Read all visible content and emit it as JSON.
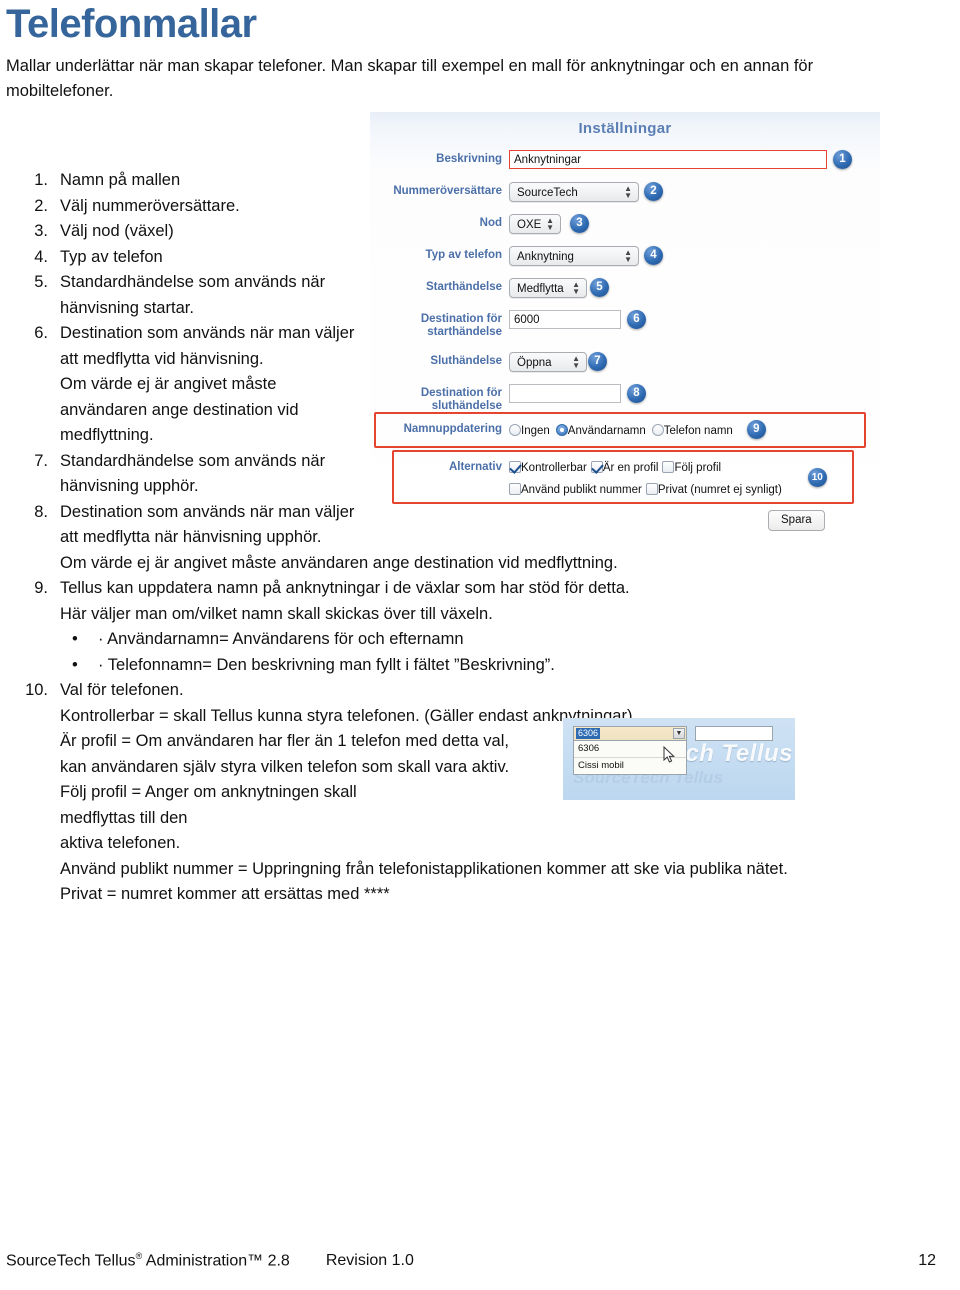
{
  "document": {
    "title": "Telefonmallar",
    "intro": "Mallar underlättar när man skapar telefoner. Man skapar till exempel en mall för anknytningar och en annan för mobiltelefoner."
  },
  "list": [
    {
      "num": "1.",
      "text": "Namn på mallen",
      "width": "narrow"
    },
    {
      "num": "2.",
      "text": "Välj nummeröversättare.",
      "width": "narrow"
    },
    {
      "num": "3.",
      "text": "Välj nod (växel)",
      "width": "narrow"
    },
    {
      "num": "4.",
      "text": "Typ av telefon",
      "width": "narrow"
    },
    {
      "num": "5.",
      "text": "Standardhändelse som används när hänvisning startar.",
      "width": "narrow"
    },
    {
      "num": "6.",
      "text": "Destination som används när man väljer att medflytta vid hänvisning.",
      "width": "narrow"
    },
    {
      "num": "",
      "text": "Om värde ej är angivet måste användaren ange destination vid medflyttning.",
      "width": "narrow"
    },
    {
      "num": "7.",
      "text": "Standardhändelse som används när hänvisning upphör.",
      "width": "narrow"
    },
    {
      "num": "8.",
      "text": "Destination som används när man väljer att medflytta när hänvisning upphör.",
      "width": "narrow"
    },
    {
      "num": "",
      "text": "Om värde ej är angivet måste användaren ange destination vid medflyttning.",
      "width": "wide"
    },
    {
      "num": "9.",
      "text": "Tellus kan uppdatera namn på anknytningar i de växlar som har stöd för detta.",
      "width": "wide"
    },
    {
      "num": "",
      "text": "Här väljer man om/vilket namn skall skickas över till växeln.",
      "width": "wide"
    }
  ],
  "bullets": [
    {
      "dot": "•",
      "text": "· Användarnamn= Användarens för och efternamn"
    },
    {
      "dot": "•",
      "text": "· Telefonnamn= Den beskrivning man fyllt i fältet ”Beskrivning”."
    }
  ],
  "list_tail": [
    {
      "num": "10.",
      "text": "Val för telefonen.",
      "width": "wide"
    },
    {
      "num": "",
      "text": "Kontrollerbar = skall Tellus kunna styra telefonen. (Gäller endast anknytningar)",
      "width": "wide"
    },
    {
      "num": "",
      "text": "Är profil = Om användaren har fler än 1 telefon med detta val,",
      "width": "wide"
    },
    {
      "num": "",
      "text": "kan användaren själv styra vilken telefon som skall vara aktiv.",
      "width": "wide"
    },
    {
      "num": "",
      "text": "Följ profil = Anger om anknytningen skall medflyttas till den",
      "width": "narrow-tail"
    },
    {
      "num": "",
      "text": "aktiva telefonen.",
      "width": "narrow-tail"
    },
    {
      "num": "",
      "text": "Använd publikt nummer = Uppringning från telefonistapplikationen kommer att ske via publika nätet.",
      "width": "wide"
    },
    {
      "num": "",
      "text": "Privat = numret kommer att ersättas med ****",
      "width": "wide"
    }
  ],
  "screenshot": {
    "title": "Inställningar",
    "fields": {
      "beskrivning": {
        "label": "Beskrivning",
        "value": "Anknytningar",
        "badge": "1"
      },
      "nummeroversattare": {
        "label": "Nummeröversättare",
        "value": "SourceTech",
        "badge": "2"
      },
      "nod": {
        "label": "Nod",
        "value": "OXE",
        "badge": "3"
      },
      "typ_av_telefon": {
        "label": "Typ av telefon",
        "value": "Anknytning",
        "badge": "4"
      },
      "starthandelse": {
        "label": "Starthändelse",
        "value": "Medflytta",
        "badge": "5"
      },
      "destination_start": {
        "label": "Destination för starthändelse",
        "value": "6000",
        "badge": "6"
      },
      "sluthandelse": {
        "label": "Sluthändelse",
        "value": "Öppna",
        "badge": "7"
      },
      "destination_slut": {
        "label": "Destination för sluthändelse",
        "value": "",
        "badge": "8"
      },
      "namnuppdatering": {
        "label": "Namnuppdatering",
        "badge": "9"
      },
      "alternativ": {
        "label": "Alternativ",
        "badge": "10"
      }
    },
    "radios": [
      {
        "label": "Ingen",
        "checked": false
      },
      {
        "label": "Användarnamn",
        "checked": true
      },
      {
        "label": "Telefon namn",
        "checked": false
      }
    ],
    "checkboxes_row1": [
      {
        "label": "Kontrollerbar",
        "checked": true
      },
      {
        "label": "Är en profil",
        "checked": true
      },
      {
        "label": "Följ profil",
        "checked": false
      }
    ],
    "checkboxes_row2": [
      {
        "label": "Använd publikt nummer",
        "checked": false
      },
      {
        "label": "Privat (numret ej synligt)",
        "checked": false
      }
    ],
    "save_button": "Spara",
    "accent_blue": "#2f6bb3",
    "highlight_red": "#e5452e",
    "label_blue": "#4b6fa8"
  },
  "mini_screenshot": {
    "combo_selected": "6306",
    "dropdown_items": [
      "6306",
      "Cissi mobil"
    ],
    "watermark": "ch Tellus",
    "watermark_faded": "SourceTech Tellus"
  },
  "footer": {
    "product": "SourceTech Tellus",
    "registered": "®",
    "product_tail": " Administration™ 2.8",
    "revision": "Revision 1.0",
    "page": "12"
  }
}
